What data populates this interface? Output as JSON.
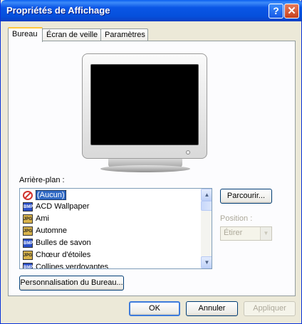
{
  "window": {
    "title": "Propriétés de Affichage",
    "help_glyph": "?",
    "close_glyph": "✕"
  },
  "tabs": [
    {
      "label": "Bureau",
      "active": true
    },
    {
      "label": "Écran de veille",
      "active": false
    },
    {
      "label": "Paramètres",
      "active": false
    }
  ],
  "background_section": {
    "label": "Arrière-plan :",
    "items": [
      {
        "label": "(Aucun)",
        "icon": "none-icon",
        "selected": true
      },
      {
        "label": "ACD Wallpaper",
        "icon": "bmp-file-icon",
        "icon_text": "BMP"
      },
      {
        "label": "Ami",
        "icon": "jpg-file-icon",
        "icon_text": "JPG"
      },
      {
        "label": "Automne",
        "icon": "jpg-file-icon",
        "icon_text": "JPG"
      },
      {
        "label": "Bulles de savon",
        "icon": "bmp-file-icon",
        "icon_text": "BMP"
      },
      {
        "label": "Chœur d'étoiles",
        "icon": "jpg-file-icon",
        "icon_text": "JPG"
      },
      {
        "label": "Collines verdoyantes",
        "icon": "bmp-file-icon",
        "icon_text": "BMP"
      }
    ],
    "browse_button": "Parcourir...",
    "position_label": "Position :",
    "position_value": "Étirer",
    "customize_button": "Personnalisation du Bureau..."
  },
  "scroll_glyphs": {
    "up": "▲",
    "down": "▼",
    "combo": "▼"
  },
  "footer": {
    "ok": "OK",
    "cancel": "Annuler",
    "apply": "Appliquer"
  },
  "colors": {
    "title_bar": "#0A56E6",
    "selection": "#316AC5",
    "active_tab_accent": "#FFC83C"
  }
}
